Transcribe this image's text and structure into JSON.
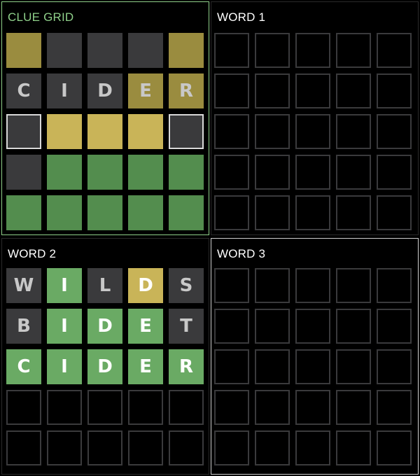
{
  "colors": {
    "background": "#000000",
    "empty_border": "#3a3a3c",
    "gray": "#3a3a3c",
    "yellow_muted": "#9a8c3f",
    "yellow_bright": "#c9b458",
    "green_dark": "#538d4e",
    "green_bright": "#6aaa64",
    "letter_muted": "#c8c8c8",
    "letter": "#ffffff",
    "title_active": "#8fd08a",
    "title": "#ffffff"
  },
  "panels": [
    {
      "key": "clue-grid",
      "title": "CLUE GRID",
      "active": true,
      "rows": [
        {
          "letters": [
            "",
            "",
            "",
            "",
            ""
          ],
          "states": [
            "yellow_muted",
            "gray",
            "gray",
            "gray",
            "yellow_muted"
          ]
        },
        {
          "letters": [
            "C",
            "I",
            "D",
            "E",
            "R"
          ],
          "states": [
            "gray",
            "gray",
            "gray",
            "yellow_muted",
            "yellow_muted"
          ]
        },
        {
          "letters": [
            "",
            "",
            "",
            "",
            ""
          ],
          "states": [
            "gray_outlined",
            "yellow_bright",
            "yellow_bright",
            "yellow_bright",
            "gray_outlined"
          ]
        },
        {
          "letters": [
            "",
            "",
            "",
            "",
            ""
          ],
          "states": [
            "gray",
            "green_dark",
            "green_dark",
            "green_dark",
            "green_dark"
          ]
        },
        {
          "letters": [
            "",
            "",
            "",
            "",
            ""
          ],
          "states": [
            "green_dark",
            "green_dark",
            "green_dark",
            "green_dark",
            "green_dark"
          ]
        }
      ]
    },
    {
      "key": "word-1",
      "title": "WORD 1",
      "active": false,
      "rows": [
        {
          "letters": [
            "",
            "",
            "",
            "",
            ""
          ],
          "states": [
            "empty",
            "empty",
            "empty",
            "empty",
            "empty"
          ]
        },
        {
          "letters": [
            "",
            "",
            "",
            "",
            ""
          ],
          "states": [
            "empty",
            "empty",
            "empty",
            "empty",
            "empty"
          ]
        },
        {
          "letters": [
            "",
            "",
            "",
            "",
            ""
          ],
          "states": [
            "empty",
            "empty",
            "empty",
            "empty",
            "empty"
          ]
        },
        {
          "letters": [
            "",
            "",
            "",
            "",
            ""
          ],
          "states": [
            "empty",
            "empty",
            "empty",
            "empty",
            "empty"
          ]
        },
        {
          "letters": [
            "",
            "",
            "",
            "",
            ""
          ],
          "states": [
            "empty",
            "empty",
            "empty",
            "empty",
            "empty"
          ]
        }
      ]
    },
    {
      "key": "word-2",
      "title": "WORD 2",
      "active": false,
      "rows": [
        {
          "letters": [
            "W",
            "I",
            "L",
            "D",
            "S"
          ],
          "states": [
            "gray",
            "green_bright",
            "gray",
            "yellow_bright",
            "gray"
          ]
        },
        {
          "letters": [
            "B",
            "I",
            "D",
            "E",
            "T"
          ],
          "states": [
            "gray",
            "green_bright",
            "green_bright",
            "green_bright",
            "gray"
          ]
        },
        {
          "letters": [
            "C",
            "I",
            "D",
            "E",
            "R"
          ],
          "states": [
            "green_bright",
            "green_bright",
            "green_bright",
            "green_bright",
            "green_bright"
          ]
        },
        {
          "letters": [
            "",
            "",
            "",
            "",
            ""
          ],
          "states": [
            "empty",
            "empty",
            "empty",
            "empty",
            "empty"
          ]
        },
        {
          "letters": [
            "",
            "",
            "",
            "",
            ""
          ],
          "states": [
            "empty",
            "empty",
            "empty",
            "empty",
            "empty"
          ]
        }
      ]
    },
    {
      "key": "word-3",
      "title": "WORD 3",
      "active": false,
      "selected": true,
      "rows": [
        {
          "letters": [
            "",
            "",
            "",
            "",
            ""
          ],
          "states": [
            "empty",
            "empty",
            "empty",
            "empty",
            "empty"
          ]
        },
        {
          "letters": [
            "",
            "",
            "",
            "",
            ""
          ],
          "states": [
            "empty",
            "empty",
            "empty",
            "empty",
            "empty"
          ]
        },
        {
          "letters": [
            "",
            "",
            "",
            "",
            ""
          ],
          "states": [
            "empty",
            "empty",
            "empty",
            "empty",
            "empty"
          ]
        },
        {
          "letters": [
            "",
            "",
            "",
            "",
            ""
          ],
          "states": [
            "empty",
            "empty",
            "empty",
            "empty",
            "empty"
          ]
        },
        {
          "letters": [
            "",
            "",
            "",
            "",
            ""
          ],
          "states": [
            "empty",
            "empty",
            "empty",
            "empty",
            "empty"
          ]
        }
      ]
    }
  ]
}
